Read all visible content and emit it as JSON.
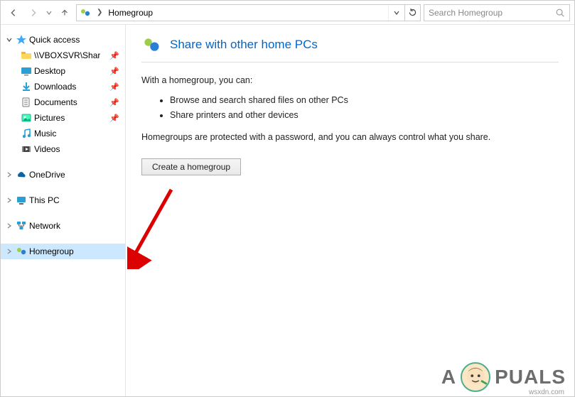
{
  "nav": {
    "breadcrumb": "Homegroup",
    "search_placeholder": "Search Homegroup"
  },
  "sidebar": {
    "quick_access": {
      "label": "Quick access",
      "items": [
        {
          "label": "\\\\VBOXSVR\\Shar",
          "pinned": true,
          "icon": "folder"
        },
        {
          "label": "Desktop",
          "pinned": true,
          "icon": "desktop"
        },
        {
          "label": "Downloads",
          "pinned": true,
          "icon": "downloads"
        },
        {
          "label": "Documents",
          "pinned": true,
          "icon": "documents"
        },
        {
          "label": "Pictures",
          "pinned": true,
          "icon": "pictures"
        },
        {
          "label": "Music",
          "pinned": false,
          "icon": "music"
        },
        {
          "label": "Videos",
          "pinned": false,
          "icon": "videos"
        }
      ]
    },
    "onedrive": {
      "label": "OneDrive"
    },
    "thispc": {
      "label": "This PC"
    },
    "network": {
      "label": "Network"
    },
    "homegroup": {
      "label": "Homegroup",
      "selected": true
    }
  },
  "content": {
    "title": "Share with other home PCs",
    "intro": "With a homegroup, you can:",
    "bullets": [
      "Browse and search shared files on other PCs",
      "Share printers and other devices"
    ],
    "note": "Homegroups are protected with a password, and you can always control what you share.",
    "button": "Create a homegroup"
  },
  "watermark": {
    "brand_left": "A",
    "brand_right": "PUALS",
    "site": "wsxdn.com"
  }
}
